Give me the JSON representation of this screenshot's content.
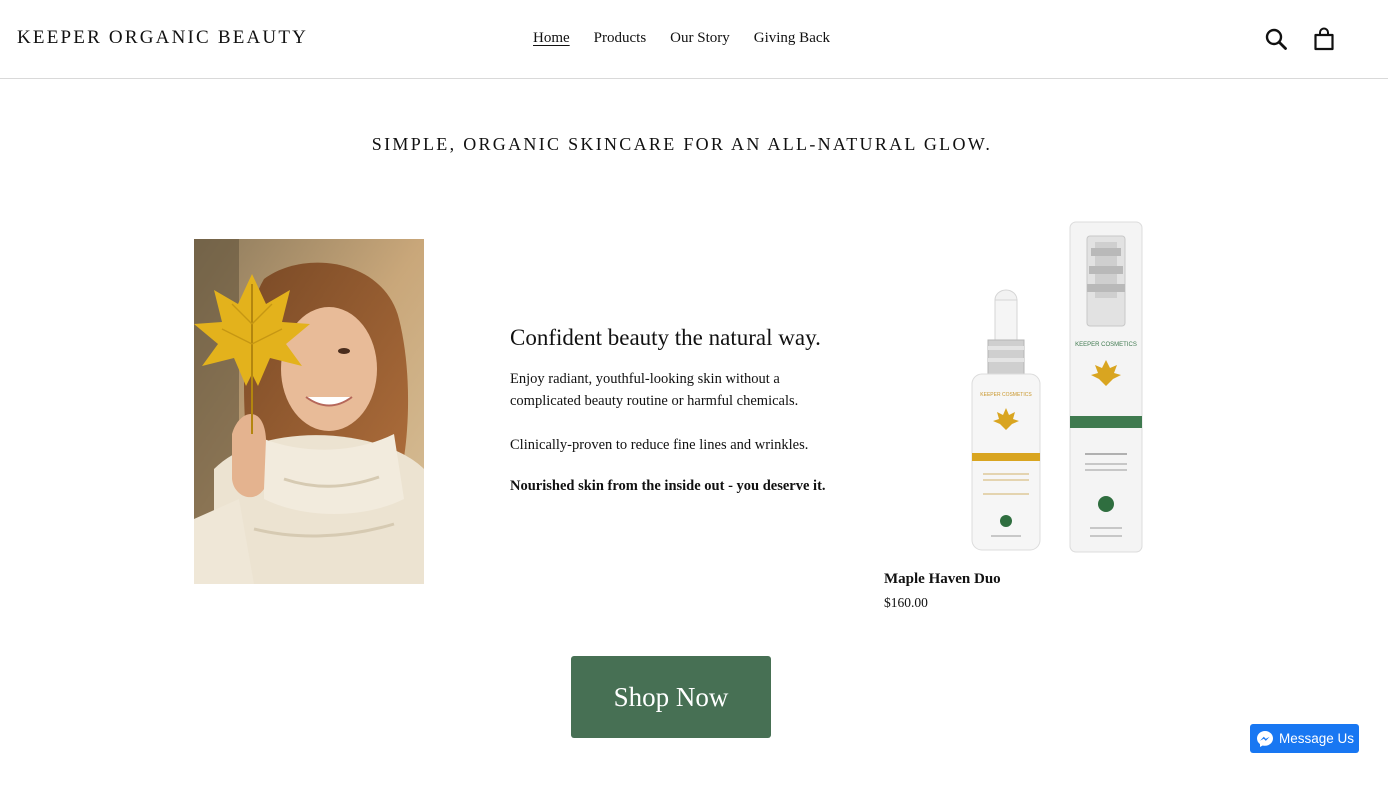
{
  "header": {
    "logo": "KEEPER ORGANIC BEAUTY",
    "nav": [
      {
        "label": "Home",
        "active": true
      },
      {
        "label": "Products",
        "active": false
      },
      {
        "label": "Our Story",
        "active": false
      },
      {
        "label": "Giving Back",
        "active": false
      }
    ],
    "icons": [
      "search-icon",
      "cart-icon"
    ]
  },
  "hero": {
    "tagline": "SIMPLE, ORGANIC SKINCARE FOR AN ALL-NATURAL GLOW.",
    "heading": "Confident beauty the natural way.",
    "paragraph1": "Enjoy radiant, youthful-looking skin without a complicated beauty routine or harmful chemicals.",
    "paragraph2": "Clinically-proven to reduce fine lines and wrinkles.",
    "paragraph3": "Nourished skin from the inside out - you deserve it."
  },
  "product": {
    "name": "Maple Haven Duo",
    "price": "$160.00"
  },
  "cta": {
    "label": "Shop Now",
    "color": "#477054"
  },
  "messenger": {
    "label": "Message Us",
    "color": "#1877f2"
  }
}
